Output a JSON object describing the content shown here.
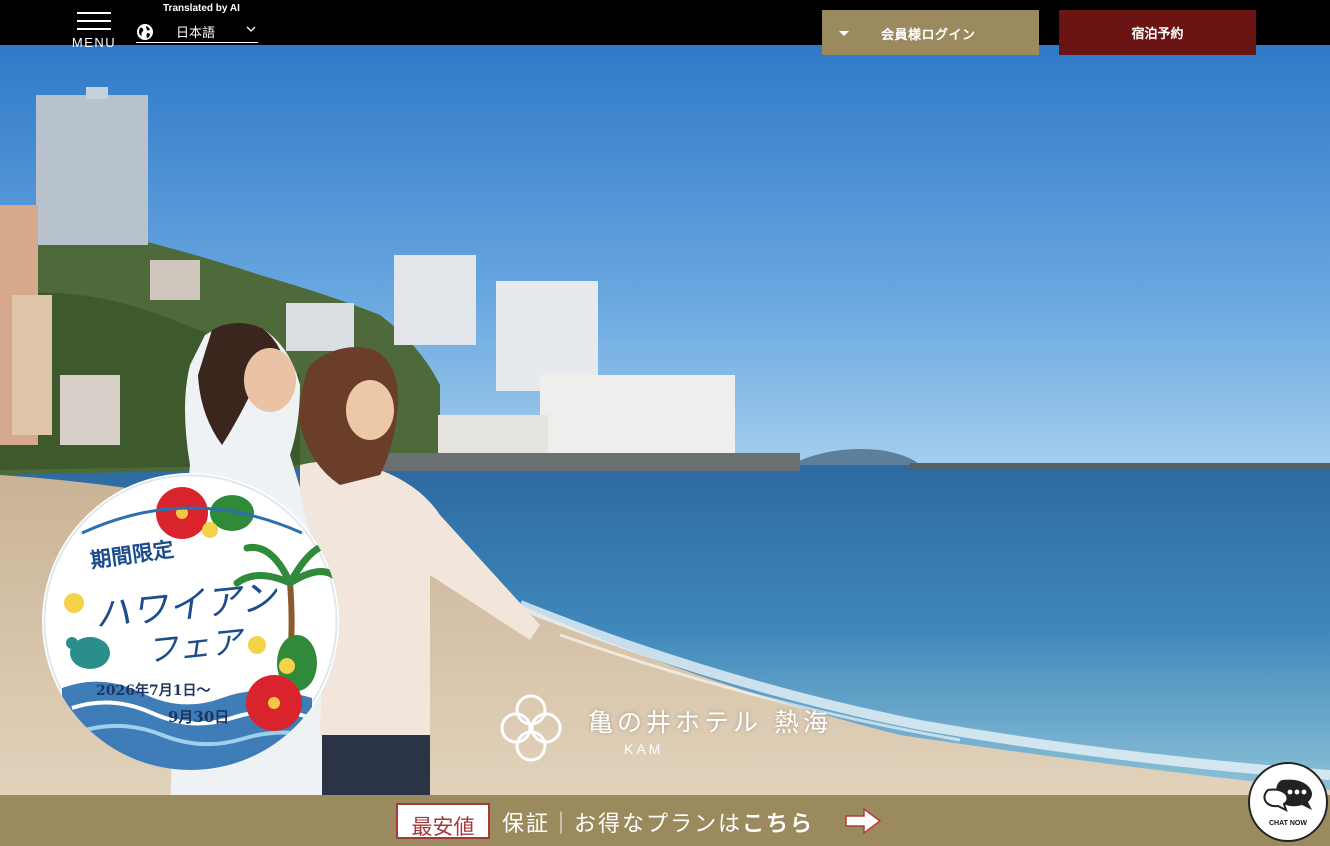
{
  "header": {
    "menu_label": "MENU",
    "translated_label": "Translated by AI",
    "language_value": "日本語",
    "login_label": "会員様ログイン",
    "reserve_label": "宿泊予約"
  },
  "hero": {
    "hotel_name": "亀の井ホテル 熱海",
    "hotel_sub": "KAM"
  },
  "badge": {
    "limited_label": "期間限定",
    "fair_line1": "ハワイアン",
    "fair_line2": "フェア",
    "date_line1": "2026年7月1日～",
    "date_line2": "9月30日"
  },
  "bottom_banner": {
    "tag": "最安値",
    "text_plain": "保証｜お得なプランは",
    "text_bold": "こちら"
  },
  "chat": {
    "label": "CHAT NOW"
  },
  "colors": {
    "gold": "#9b8a5e",
    "maroon": "#6b1414",
    "tag_red": "#a33a3a",
    "navy": "#1d4d8c"
  }
}
